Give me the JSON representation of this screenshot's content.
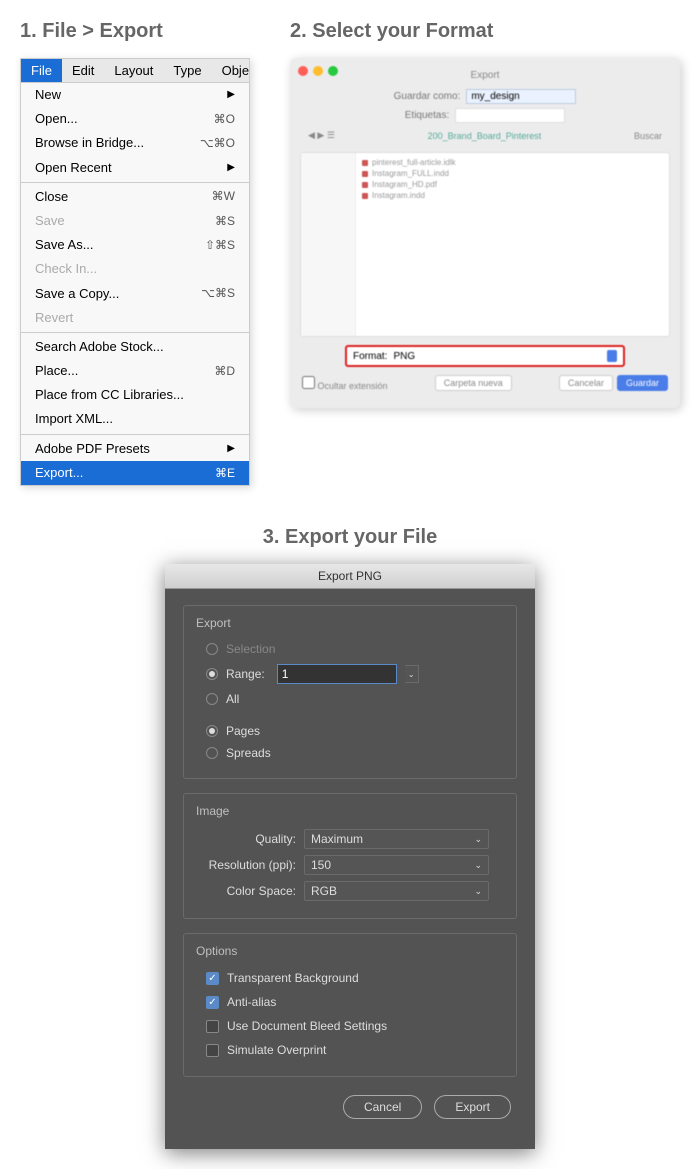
{
  "step1": {
    "title": "1. File > Export",
    "menubar": [
      "File",
      "Edit",
      "Layout",
      "Type",
      "Obje"
    ],
    "items": [
      {
        "label": "New",
        "chevron": true
      },
      {
        "label": "Open...",
        "shortcut": "⌘O"
      },
      {
        "label": "Browse in Bridge...",
        "shortcut": "⌥⌘O"
      },
      {
        "label": "Open Recent",
        "chevron": true
      },
      {
        "sep": true
      },
      {
        "label": "Close",
        "shortcut": "⌘W"
      },
      {
        "label": "Save",
        "shortcut": "⌘S",
        "disabled": true
      },
      {
        "label": "Save As...",
        "shortcut": "⇧⌘S"
      },
      {
        "label": "Check In...",
        "disabled": true
      },
      {
        "label": "Save a Copy...",
        "shortcut": "⌥⌘S"
      },
      {
        "label": "Revert",
        "disabled": true
      },
      {
        "sep": true
      },
      {
        "label": "Search Adobe Stock..."
      },
      {
        "label": "Place...",
        "shortcut": "⌘D"
      },
      {
        "label": "Place from CC Libraries..."
      },
      {
        "label": "Import XML..."
      },
      {
        "sep": true
      },
      {
        "label": "Adobe PDF Presets",
        "chevron": true
      },
      {
        "label": "Export...",
        "shortcut": "⌘E",
        "highlighted": true
      }
    ]
  },
  "step2": {
    "title": "2. Select your Format",
    "window_title": "Export",
    "save_as_label": "Guardar como:",
    "save_as_value": "my_design",
    "tags_label": "Etiquetas:",
    "folder": "200_Brand_Board_Pinterest",
    "search_placeholder": "Buscar",
    "files": [
      "pinterest_full-article.idlk",
      "Instagram_FULL.indd",
      "Instagram_HD.pdf",
      "Instagram.indd"
    ],
    "format_label": "Format:",
    "format_value": "PNG",
    "hide_ext": "Ocultar extensión",
    "new_folder": "Carpeta nueva",
    "cancel": "Cancelar",
    "save": "Guardar"
  },
  "step3": {
    "title": "3. Export your File",
    "dialog_title": "Export PNG",
    "export_section": "Export",
    "selection_label": "Selection",
    "range_label": "Range:",
    "range_value": "1",
    "all_label": "All",
    "pages_label": "Pages",
    "spreads_label": "Spreads",
    "image_section": "Image",
    "quality_label": "Quality:",
    "quality_value": "Maximum",
    "resolution_label": "Resolution (ppi):",
    "resolution_value": "150",
    "colorspace_label": "Color Space:",
    "colorspace_value": "RGB",
    "options_section": "Options",
    "transparent_label": "Transparent Background",
    "antialias_label": "Anti-alias",
    "bleed_label": "Use Document Bleed Settings",
    "overprint_label": "Simulate Overprint",
    "cancel_btn": "Cancel",
    "export_btn": "Export"
  }
}
